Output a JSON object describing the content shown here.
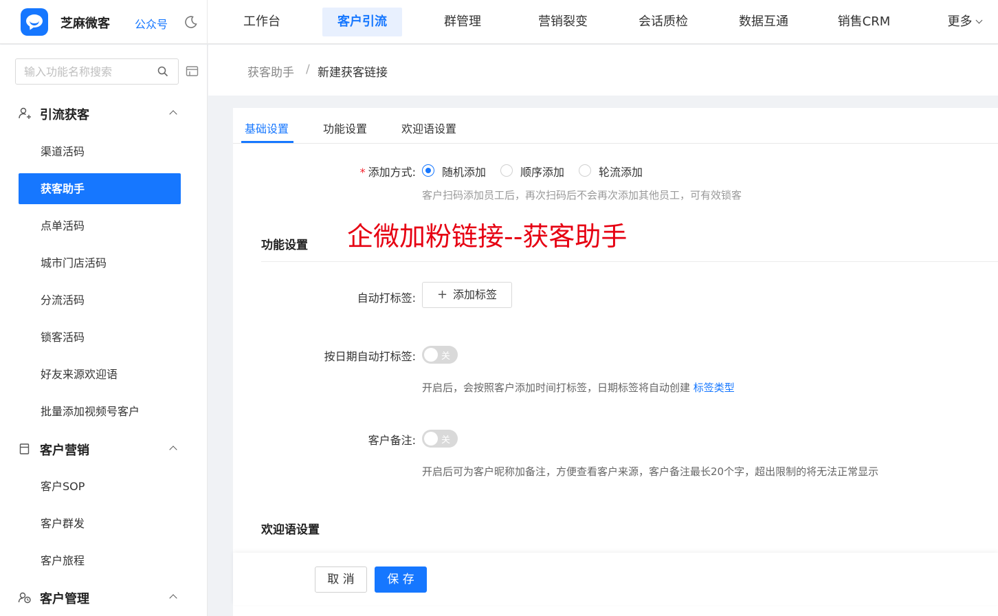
{
  "header": {
    "brand_name": "芝麻微客",
    "brand_link": "公众号",
    "nav": [
      {
        "label": "工作台"
      },
      {
        "label": "客户引流"
      },
      {
        "label": "群管理"
      },
      {
        "label": "营销裂变"
      },
      {
        "label": "会话质检"
      },
      {
        "label": "数据互通"
      },
      {
        "label": "销售CRM"
      },
      {
        "label": "更多"
      }
    ],
    "active_nav": "客户引流"
  },
  "sidebar": {
    "search_placeholder": "输入功能名称搜索",
    "groups": [
      {
        "label": "引流获客",
        "icon": "user-add-icon",
        "items": [
          {
            "label": "渠道活码"
          },
          {
            "label": "获客助手"
          },
          {
            "label": "点单活码"
          },
          {
            "label": "城市门店活码"
          },
          {
            "label": "分流活码"
          },
          {
            "label": "锁客活码"
          },
          {
            "label": "好友来源欢迎语"
          },
          {
            "label": "批量添加视频号客户"
          }
        ]
      },
      {
        "label": "客户营销",
        "icon": "calendar-icon",
        "items": [
          {
            "label": "客户SOP"
          },
          {
            "label": "客户群发"
          },
          {
            "label": "客户旅程"
          }
        ]
      },
      {
        "label": "客户管理",
        "icon": "customer-manage-icon",
        "items": []
      }
    ],
    "active_item": "获客助手"
  },
  "breadcrumb": {
    "parent": "获客助手",
    "separator": "/",
    "current": "新建获客链接"
  },
  "tabs": [
    {
      "label": "基础设置"
    },
    {
      "label": "功能设置"
    },
    {
      "label": "欢迎语设置"
    }
  ],
  "form": {
    "add_mode": {
      "label": "添加方式:",
      "required_mark": "*",
      "options": [
        {
          "label": "随机添加",
          "checked": true
        },
        {
          "label": "顺序添加",
          "checked": false
        },
        {
          "label": "轮流添加",
          "checked": false
        }
      ],
      "hint": "客户扫码添加员工后，再次扫码后不会再次添加其他员工，可有效锁客"
    },
    "function_section_title": "功能设置",
    "overlay_title": "企微加粉链接--获客助手",
    "auto_tag": {
      "label": "自动打标签:",
      "button_label": "添加标签"
    },
    "date_tag": {
      "label": "按日期自动打标签:",
      "switch_text": "关",
      "enabled": false,
      "hint": "开启后，会按照客户添加时间打标签，日期标签将自动创建 ",
      "hint_link": "标签类型"
    },
    "remark": {
      "label": "客户备注:",
      "switch_text": "关",
      "enabled": false,
      "hint": "开启后可为客户昵称加备注，方便查看客户来源，客户备注最长20个字，超出限制的将无法正常显示"
    },
    "welcome_section_title": "欢迎语设置"
  },
  "footer": {
    "cancel_label": "取 消",
    "save_label": "保 存"
  },
  "colors": {
    "primary": "#1677ff",
    "overlay_red": "#e60012",
    "required": "#f5222d"
  }
}
